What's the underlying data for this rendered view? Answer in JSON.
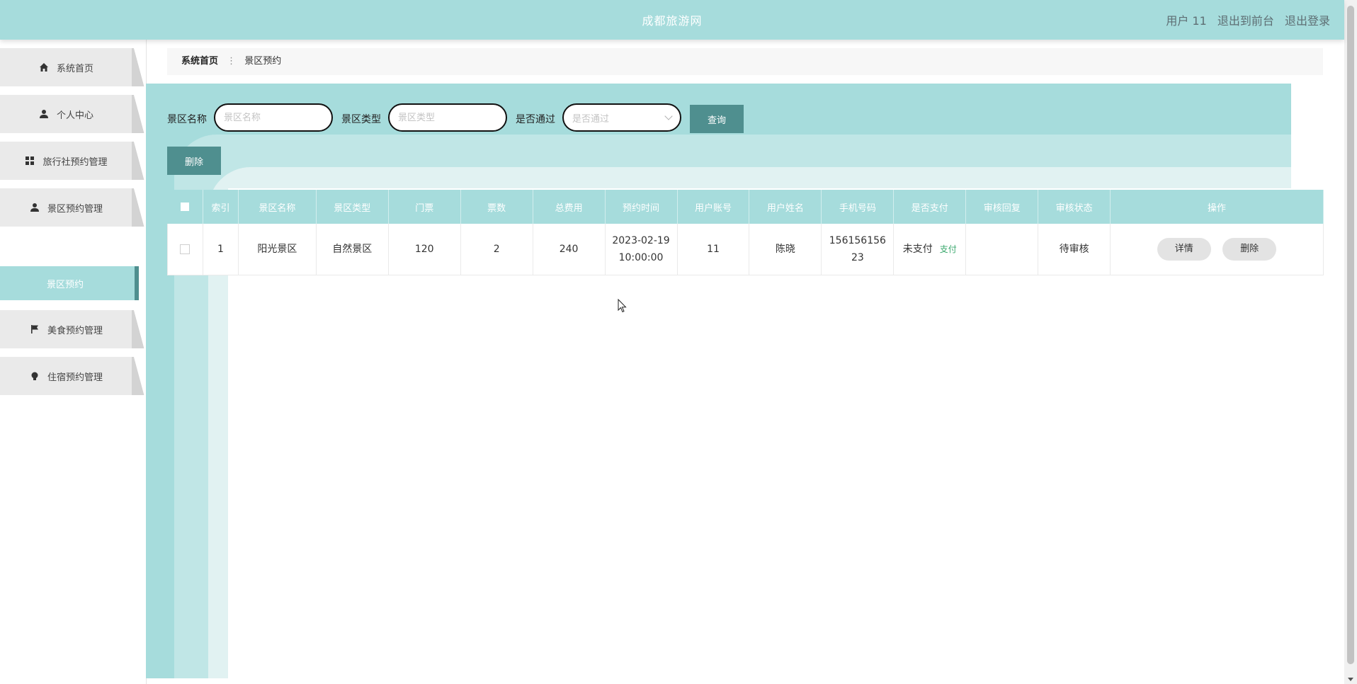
{
  "header": {
    "title": "成都旅游网",
    "user": "用户 11",
    "to_front": "退出到前台",
    "logout": "退出登录"
  },
  "sidebar": {
    "items": [
      {
        "label": "系统首页",
        "icon": "home-icon"
      },
      {
        "label": "个人中心",
        "icon": "user-icon"
      },
      {
        "label": "旅行社预约管理",
        "icon": "grid-icon"
      },
      {
        "label": "景区预约管理",
        "icon": "user-group-icon"
      },
      {
        "label": "美食预约管理",
        "icon": "flag-icon"
      },
      {
        "label": "住宿预约管理",
        "icon": "bulb-icon"
      }
    ],
    "active_sub": "景区预约"
  },
  "breadcrumb": {
    "home": "系统首页",
    "current": "景区预约"
  },
  "search": {
    "name_label": "景区名称",
    "name_placeholder": "景区名称",
    "type_label": "景区类型",
    "type_placeholder": "景区类型",
    "pass_label": "是否通过",
    "pass_placeholder": "是否通过",
    "query_button": "查询"
  },
  "toolbar": {
    "delete_button": "删除"
  },
  "table": {
    "headers": [
      "索引",
      "景区名称",
      "景区类型",
      "门票",
      "票数",
      "总费用",
      "预约时间",
      "用户账号",
      "用户姓名",
      "手机号码",
      "是否支付",
      "审核回复",
      "审核状态",
      "操作"
    ],
    "rows": [
      {
        "index": "1",
        "name": "阳光景区",
        "type": "自然景区",
        "ticket": "120",
        "count": "2",
        "total": "240",
        "time_date": "2023-02-19",
        "time_clock": "10:00:00",
        "account": "11",
        "username": "陈晓",
        "phone_line1": "156156156",
        "phone_line2": "23",
        "paid": "未支付",
        "pay_link": "支付",
        "reply": "",
        "status": "待审核",
        "detail_button": "详情",
        "delete_button": "删除"
      }
    ]
  },
  "colors": {
    "accent": "#a6dcdc",
    "button": "#4f8f8f",
    "link_green": "#3aa86d"
  }
}
